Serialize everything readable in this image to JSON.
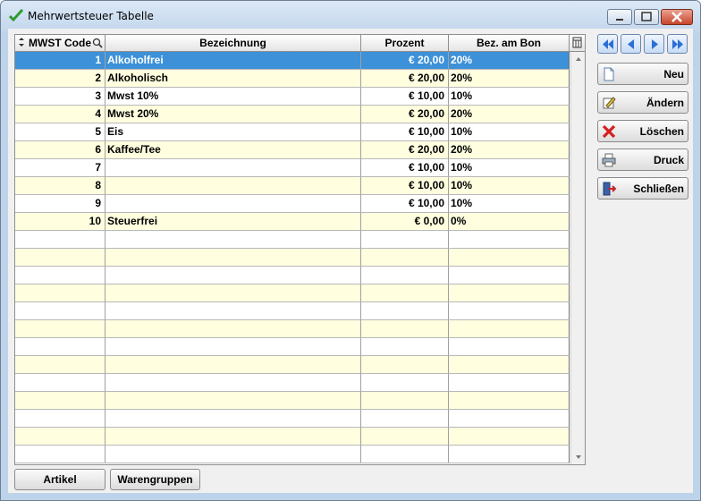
{
  "window": {
    "title": "Mehrwertsteuer Tabelle"
  },
  "columns": [
    "MWST Code",
    "Bezeichnung",
    "Prozent",
    "Bez. am Bon"
  ],
  "rows": [
    {
      "code": "1",
      "name": "Alkoholfrei",
      "percent": "€ 20,00",
      "bon": "20%",
      "selected": true
    },
    {
      "code": "2",
      "name": "Alkoholisch",
      "percent": "€ 20,00",
      "bon": "20%"
    },
    {
      "code": "3",
      "name": "Mwst 10%",
      "percent": "€ 10,00",
      "bon": "10%"
    },
    {
      "code": "4",
      "name": "Mwst 20%",
      "percent": "€ 20,00",
      "bon": "20%"
    },
    {
      "code": "5",
      "name": "Eis",
      "percent": "€ 10,00",
      "bon": "10%"
    },
    {
      "code": "6",
      "name": "Kaffee/Tee",
      "percent": "€ 20,00",
      "bon": "20%"
    },
    {
      "code": "7",
      "name": "",
      "percent": "€ 10,00",
      "bon": "10%"
    },
    {
      "code": "8",
      "name": "",
      "percent": "€ 10,00",
      "bon": "10%"
    },
    {
      "code": "9",
      "name": "",
      "percent": "€ 10,00",
      "bon": "10%"
    },
    {
      "code": "10",
      "name": "Steuerfrei",
      "percent": "€ 0,00",
      "bon": "0%"
    }
  ],
  "empty_rows": 13,
  "actions": {
    "new": "Neu",
    "edit": "Ändern",
    "delete": "Löschen",
    "print": "Druck",
    "close": "Schließen"
  },
  "bottom": {
    "articles": "Artikel",
    "groups": "Warengruppen"
  },
  "colors": {
    "selection": "#3d91d8",
    "row_alt": "#ffffe0",
    "delete_icon": "#d42020"
  }
}
